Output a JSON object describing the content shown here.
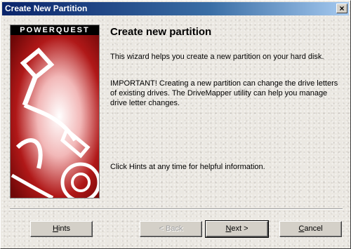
{
  "window": {
    "title": "Create New Partition",
    "close_label": "×"
  },
  "banner": {
    "brand": "POWERQUEST"
  },
  "content": {
    "heading": "Create new partition",
    "intro": "This wizard helps you create a new partition on your hard disk.",
    "important": "IMPORTANT!  Creating a new partition can change the drive letters of existing drives. The DriveMapper utility can help you manage drive letter changes.",
    "hint_text": "Click Hints at any time for helpful information."
  },
  "buttons": {
    "hints": {
      "mnemonic": "H",
      "rest": "ints"
    },
    "back": {
      "label": "< Back"
    },
    "next": {
      "mnemonic": "N",
      "rest": "ext >"
    },
    "cancel": {
      "mnemonic": "C",
      "rest": "ancel"
    }
  }
}
